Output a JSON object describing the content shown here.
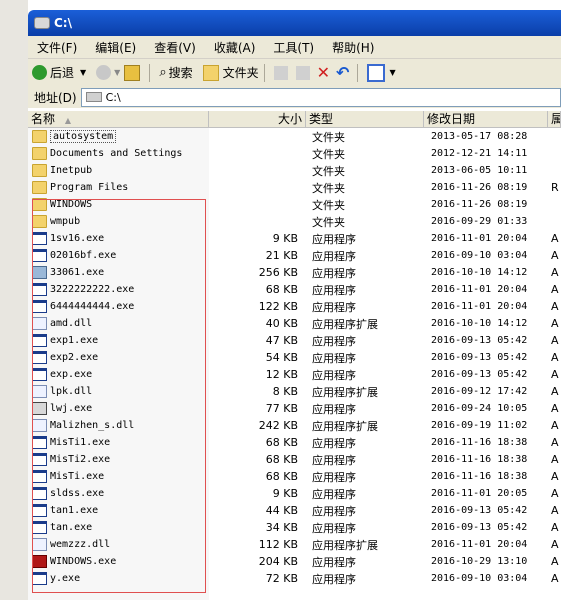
{
  "window": {
    "title": "C:\\"
  },
  "menu": [
    "文件(F)",
    "编辑(E)",
    "查看(V)",
    "收藏(A)",
    "工具(T)",
    "帮助(H)"
  ],
  "toolbar": {
    "back": "后退",
    "search": "搜索",
    "folders": "文件夹"
  },
  "address": {
    "label": "地址(D)",
    "value": "C:\\"
  },
  "columns": {
    "name": "名称",
    "size": "大小",
    "type": "类型",
    "date": "修改日期",
    "attr": "属"
  },
  "files": [
    {
      "name": "autosystem",
      "size": "",
      "type": "文件夹",
      "date": "2013-05-17 08:28",
      "attr": "",
      "icon": "folder-icon"
    },
    {
      "name": "Documents and Settings",
      "size": "",
      "type": "文件夹",
      "date": "2012-12-21 14:11",
      "attr": "",
      "icon": "folder-icon"
    },
    {
      "name": "Inetpub",
      "size": "",
      "type": "文件夹",
      "date": "2013-06-05 10:11",
      "attr": "",
      "icon": "folder-icon"
    },
    {
      "name": "Program Files",
      "size": "",
      "type": "文件夹",
      "date": "2016-11-26 08:19",
      "attr": "R",
      "icon": "folder-icon"
    },
    {
      "name": "WINDOWS",
      "size": "",
      "type": "文件夹",
      "date": "2016-11-26 08:19",
      "attr": "",
      "icon": "folder-icon"
    },
    {
      "name": "wmpub",
      "size": "",
      "type": "文件夹",
      "date": "2016-09-29 01:33",
      "attr": "",
      "icon": "folder-icon"
    },
    {
      "name": "1sv16.exe",
      "size": "9 KB",
      "type": "应用程序",
      "date": "2016-11-01 20:04",
      "attr": "A",
      "icon": "application-icon"
    },
    {
      "name": "02016bf.exe",
      "size": "21 KB",
      "type": "应用程序",
      "date": "2016-09-10 03:04",
      "attr": "A",
      "icon": "application-icon"
    },
    {
      "name": "33061.exe",
      "size": "256 KB",
      "type": "应用程序",
      "date": "2016-10-10 14:12",
      "attr": "A",
      "icon": "image-app-icon"
    },
    {
      "name": "3222222222.exe",
      "size": "68 KB",
      "type": "应用程序",
      "date": "2016-11-01 20:04",
      "attr": "A",
      "icon": "application-icon"
    },
    {
      "name": "6444444444.exe",
      "size": "122 KB",
      "type": "应用程序",
      "date": "2016-11-01 20:04",
      "attr": "A",
      "icon": "application-icon"
    },
    {
      "name": "amd.dll",
      "size": "40 KB",
      "type": "应用程序扩展",
      "date": "2016-10-10 14:12",
      "attr": "A",
      "icon": "dll-icon"
    },
    {
      "name": "exp1.exe",
      "size": "47 KB",
      "type": "应用程序",
      "date": "2016-09-13 05:42",
      "attr": "A",
      "icon": "application-icon"
    },
    {
      "name": "exp2.exe",
      "size": "54 KB",
      "type": "应用程序",
      "date": "2016-09-13 05:42",
      "attr": "A",
      "icon": "application-icon"
    },
    {
      "name": "exp.exe",
      "size": "12 KB",
      "type": "应用程序",
      "date": "2016-09-13 05:42",
      "attr": "A",
      "icon": "application-icon"
    },
    {
      "name": "lpk.dll",
      "size": "8 KB",
      "type": "应用程序扩展",
      "date": "2016-09-12 17:42",
      "attr": "A",
      "icon": "dll-icon"
    },
    {
      "name": "lwj.exe",
      "size": "77 KB",
      "type": "应用程序",
      "date": "2016-09-24 10:05",
      "attr": "A",
      "icon": "special-app-icon"
    },
    {
      "name": "Malizhen_s.dll",
      "size": "242 KB",
      "type": "应用程序扩展",
      "date": "2016-09-19 11:02",
      "attr": "A",
      "icon": "dll-icon"
    },
    {
      "name": "MisTi1.exe",
      "size": "68 KB",
      "type": "应用程序",
      "date": "2016-11-16 18:38",
      "attr": "A",
      "icon": "application-icon"
    },
    {
      "name": "MisTi2.exe",
      "size": "68 KB",
      "type": "应用程序",
      "date": "2016-11-16 18:38",
      "attr": "A",
      "icon": "application-icon"
    },
    {
      "name": "MisTi.exe",
      "size": "68 KB",
      "type": "应用程序",
      "date": "2016-11-16 18:38",
      "attr": "A",
      "icon": "application-icon"
    },
    {
      "name": "sldss.exe",
      "size": "9 KB",
      "type": "应用程序",
      "date": "2016-11-01 20:05",
      "attr": "A",
      "icon": "application-icon"
    },
    {
      "name": "tan1.exe",
      "size": "44 KB",
      "type": "应用程序",
      "date": "2016-09-13 05:42",
      "attr": "A",
      "icon": "application-icon"
    },
    {
      "name": "tan.exe",
      "size": "34 KB",
      "type": "应用程序",
      "date": "2016-09-13 05:42",
      "attr": "A",
      "icon": "application-icon"
    },
    {
      "name": "wemzzz.dll",
      "size": "112 KB",
      "type": "应用程序扩展",
      "date": "2016-11-01 20:04",
      "attr": "A",
      "icon": "dll-icon"
    },
    {
      "name": "WINDOWS.exe",
      "size": "204 KB",
      "type": "应用程序",
      "date": "2016-10-29 13:10",
      "attr": "A",
      "icon": "shortcut-app-icon"
    },
    {
      "name": "y.exe",
      "size": "72 KB",
      "type": "应用程序",
      "date": "2016-09-10 03:04",
      "attr": "A",
      "icon": "application-icon"
    }
  ]
}
